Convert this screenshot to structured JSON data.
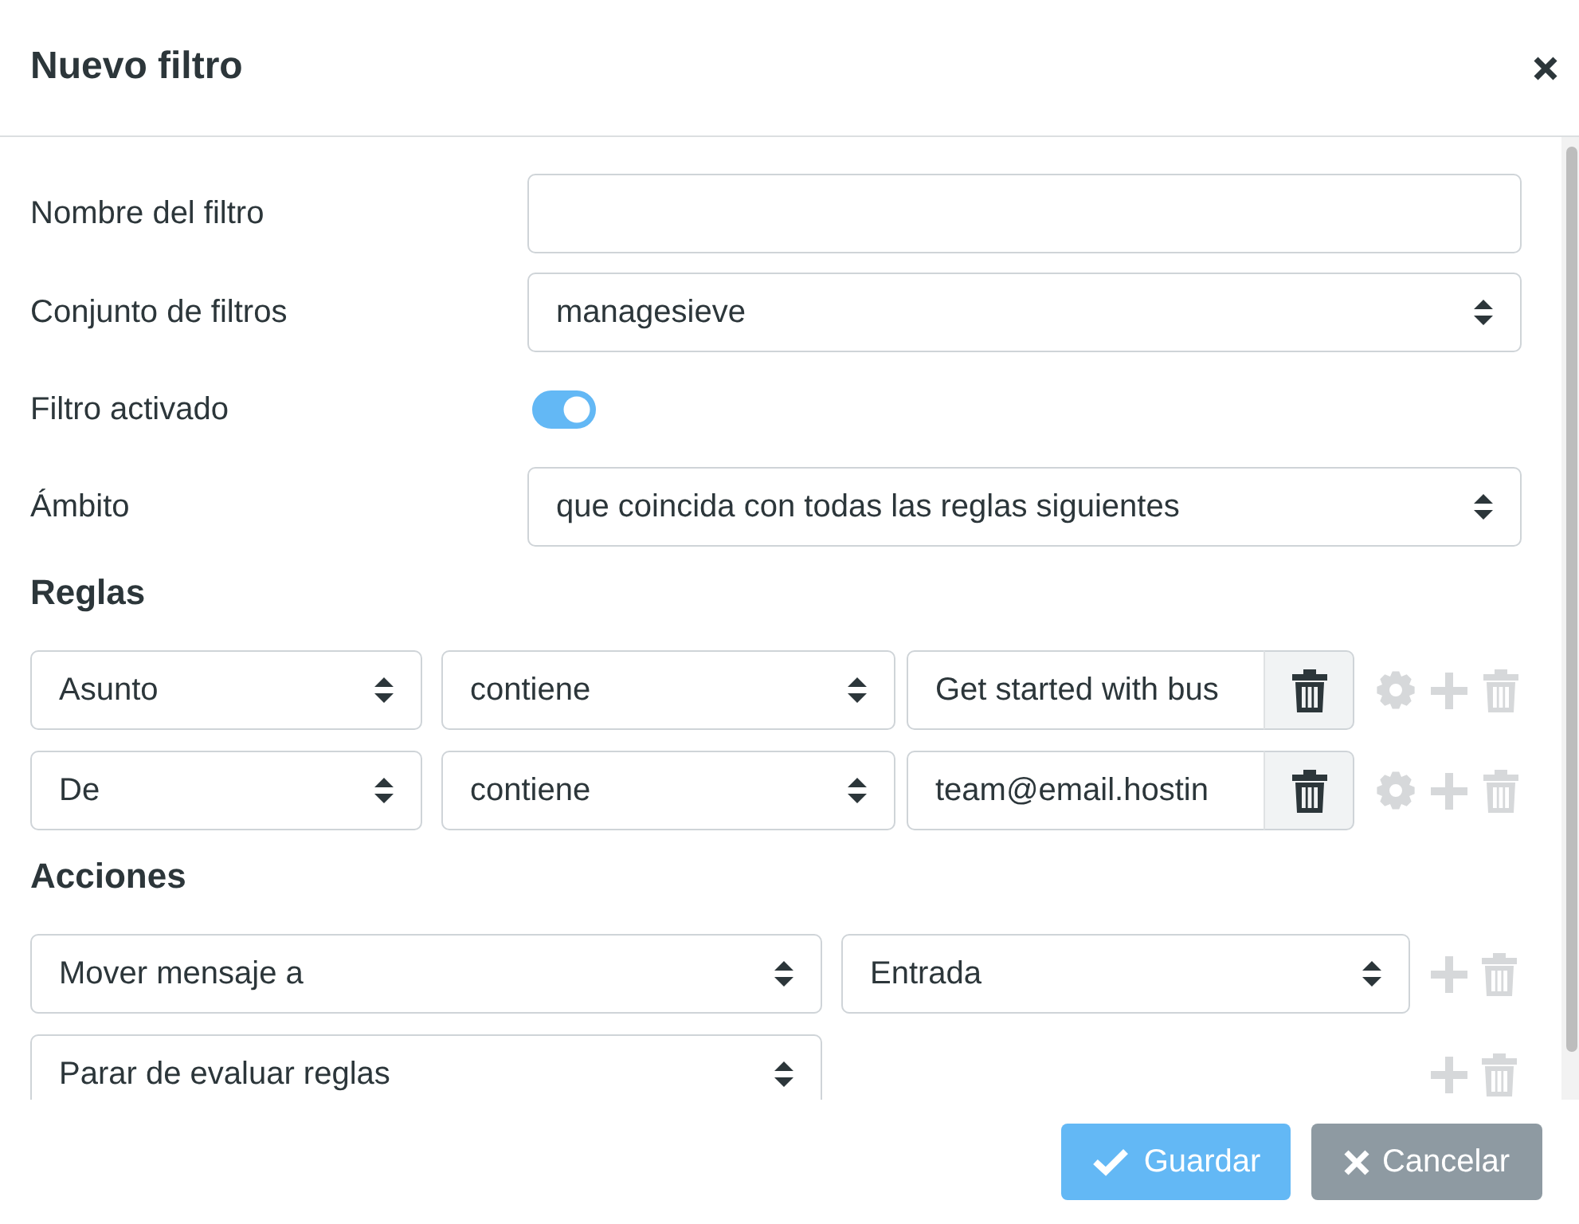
{
  "dialog": {
    "title": "Nuevo filtro"
  },
  "fields": [
    {
      "kind": "text",
      "label": "Nombre del filtro"
    },
    {
      "kind": "select",
      "label": "Conjunto de filtros",
      "value": "managesieve"
    },
    {
      "kind": "switch",
      "label": "Filtro activado",
      "on": true
    },
    {
      "kind": "select",
      "label": "Ámbito",
      "value": "que coincida con todas las reglas siguientes"
    }
  ],
  "rules": {
    "heading": "Reglas",
    "rows": [
      {
        "header": "Asunto",
        "operator": "contiene",
        "value": "Get started with bus"
      },
      {
        "header": "De",
        "operator": "contiene",
        "value": "team@email.hostin"
      }
    ]
  },
  "actions": {
    "heading": "Acciones",
    "rows": [
      {
        "action": "Mover mensaje a",
        "target": "Entrada"
      },
      {
        "action": "Parar de evaluar reglas"
      }
    ]
  },
  "buttons": [
    {
      "kind": "save",
      "label": "Guardar"
    },
    {
      "kind": "cancel",
      "label": "Cancelar"
    }
  ]
}
